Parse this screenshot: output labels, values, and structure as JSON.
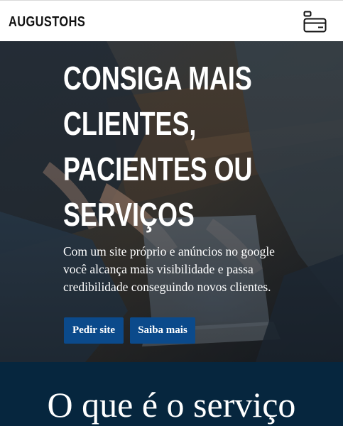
{
  "navbar": {
    "brand": "AUGUSTOHS",
    "menu_icon": "menu-icon"
  },
  "hero": {
    "title_lines": [
      "CONSIGA MAIS",
      "CLIENTES,",
      "PACIENTES OU",
      "SERVIÇOS"
    ],
    "text": "Com um site próprio e anúncios no google você alcança mais visibilidade e passa credibilidade conseguindo novos clientes.",
    "primary_button": "Pedir site",
    "secondary_button": "Saiba mais",
    "background_image": "people-laptop-photo"
  },
  "section": {
    "title": "O que é o serviço"
  },
  "colors": {
    "button": "#0b4a8b",
    "section_bg": "#06263e",
    "navbar_bg": "#ffffff",
    "text_light": "#ffffff"
  }
}
